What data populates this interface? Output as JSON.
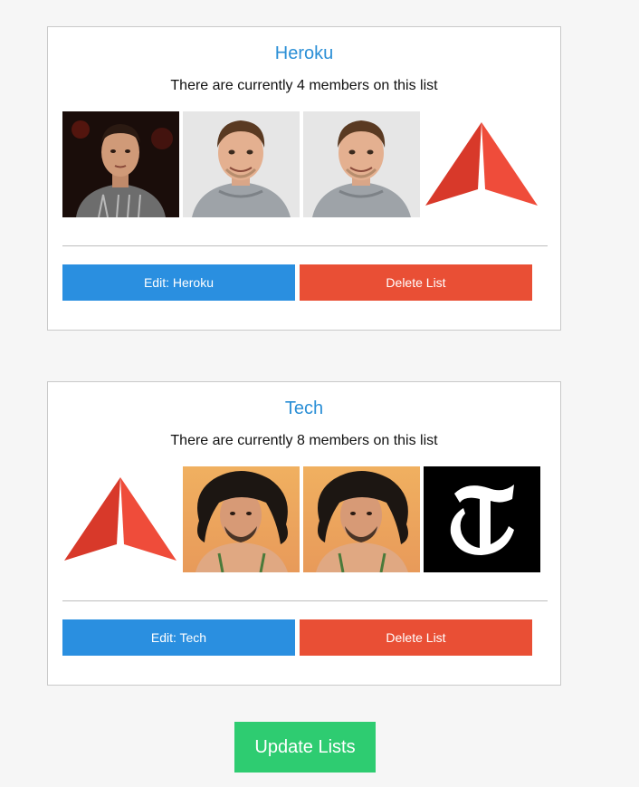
{
  "lists": [
    {
      "title": "Heroku",
      "member_text": "There are currently 4 members on this list",
      "edit_label": "Edit: Heroku",
      "delete_label": "Delete List",
      "avatars": [
        "person-dark-photo",
        "person-hoodie-photo",
        "person-hoodie-photo",
        "red-arrow-logo"
      ]
    },
    {
      "title": "Tech",
      "member_text": "There are currently 8 members on this list",
      "edit_label": "Edit: Tech",
      "delete_label": "Delete List",
      "avatars": [
        "red-arrow-logo",
        "person-curly-hair-photo",
        "person-curly-hair-photo",
        "nyt-logo"
      ]
    }
  ],
  "update_label": "Update Lists",
  "colors": {
    "title": "#2b8fd6",
    "edit_button": "#2a8fe0",
    "delete_button": "#e94f35",
    "update_button": "#2ecc71"
  }
}
